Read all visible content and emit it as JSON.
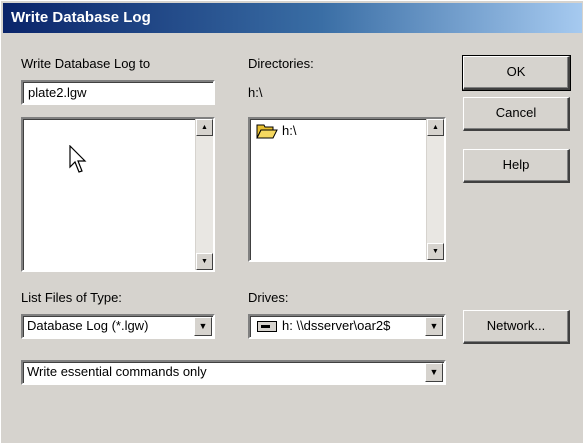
{
  "window": {
    "title": "Write Database Log"
  },
  "log_to": {
    "label": "Write Database Log to",
    "value": "plate2.lgw"
  },
  "directories": {
    "label": "Directories:",
    "current": "h:\\",
    "items": [
      "h:\\"
    ]
  },
  "file_type": {
    "label": "List Files of Type:",
    "selected": "Database Log (*.lgw)"
  },
  "drives": {
    "label": "Drives:",
    "selected": "h: \\\\dsserver\\oar2$"
  },
  "mode": {
    "selected": "Write essential commands only"
  },
  "buttons": {
    "ok": "OK",
    "cancel": "Cancel",
    "help": "Help",
    "network": "Network..."
  }
}
